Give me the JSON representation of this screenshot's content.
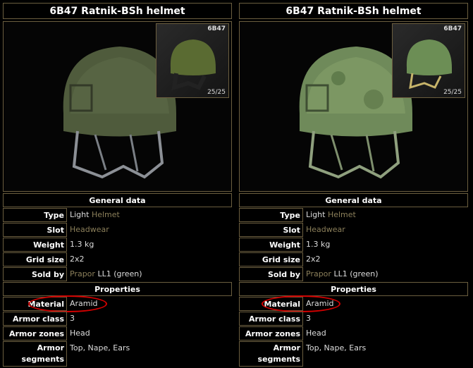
{
  "panels": [
    {
      "title": "6B47 Ratnik-BSh helmet",
      "thumb_name": "6B47",
      "thumb_count": "25/25",
      "helmet_color": "#4f5b3c",
      "general_header": "General data",
      "properties_header": "Properties",
      "type_key": "Type",
      "type_val": "Light",
      "type_link": "Helmet",
      "slot_key": "Slot",
      "slot_val": "Headwear",
      "weight_key": "Weight",
      "weight_val": "1.3 kg",
      "grid_key": "Grid size",
      "grid_val": "2x2",
      "sold_key": "Sold by",
      "sold_link": "Prapor",
      "sold_val": "LL1 (green)",
      "material_key": "Material",
      "material_val": "Aramid",
      "armorclass_key": "Armor class",
      "armorclass_val": "3",
      "zones_key": "Armor zones",
      "zones_val": "Head",
      "segments_key": "Armor segments",
      "segments_val": "Top, Nape, Ears"
    },
    {
      "title": "6B47 Ratnik-BSh helmet",
      "thumb_name": "6B47",
      "thumb_count": "25/25",
      "helmet_color": "#6f8a5a",
      "general_header": "General data",
      "properties_header": "Properties",
      "type_key": "Type",
      "type_val": "Light",
      "type_link": "Helmet",
      "slot_key": "Slot",
      "slot_val": "Headwear",
      "weight_key": "Weight",
      "weight_val": "1.3 kg",
      "grid_key": "Grid size",
      "grid_val": "2x2",
      "sold_key": "Sold by",
      "sold_link": "Prapor",
      "sold_val": "LL1 (green)",
      "material_key": "Material",
      "material_val": "Aramid",
      "armorclass_key": "Armor class",
      "armorclass_val": "3",
      "zones_key": "Armor zones",
      "zones_val": "Head",
      "segments_key": "Armor segments",
      "segments_val": "Top, Nape, Ears"
    }
  ],
  "colors": {
    "border": "#6b5e3f",
    "highlight_circle": "#d40000",
    "link": "#8b7f5a"
  }
}
